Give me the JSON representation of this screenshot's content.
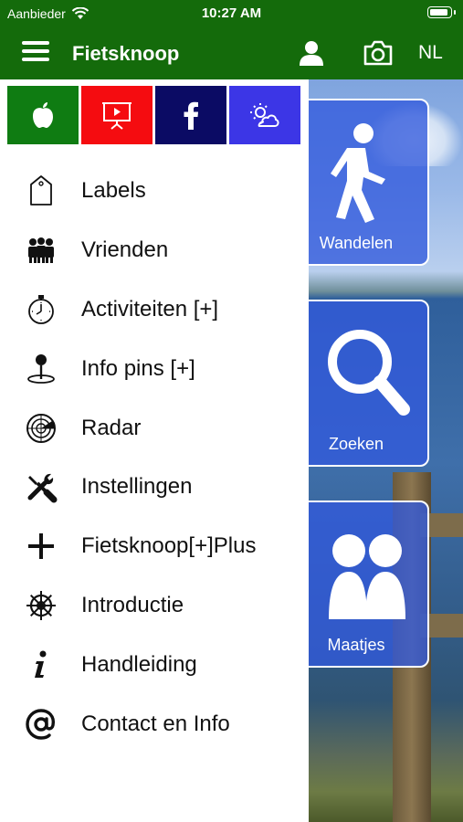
{
  "status_bar": {
    "carrier": "Aanbieder",
    "time": "10:27 AM"
  },
  "nav": {
    "title": "Fietsknoop",
    "language": "NL"
  },
  "quick_links": [
    "apple-icon",
    "presentation-icon",
    "facebook-icon",
    "weather-icon"
  ],
  "menu": {
    "items": [
      {
        "label": "Labels",
        "icon": "tag-icon"
      },
      {
        "label": "Vrienden",
        "icon": "group-icon"
      },
      {
        "label": "Activiteiten [+]",
        "icon": "stopwatch-icon"
      },
      {
        "label": "Info pins [+]",
        "icon": "map-pin-icon"
      },
      {
        "label": "Radar",
        "icon": "radar-icon"
      },
      {
        "label": "Instellingen",
        "icon": "tools-icon"
      },
      {
        "label": "Fietsknoop[+]Plus",
        "icon": "plus-icon"
      },
      {
        "label": "Introductie",
        "icon": "helm-icon"
      },
      {
        "label": "Handleiding",
        "icon": "info-icon"
      },
      {
        "label": "Contact en Info",
        "icon": "at-icon"
      }
    ]
  },
  "tiles": {
    "walk": {
      "label": "Wandelen",
      "icon": "walking-person-icon"
    },
    "search": {
      "label": "Zoeken",
      "icon": "magnifier-icon"
    },
    "buddies": {
      "label": "Maatjes",
      "icon": "people-icon"
    }
  },
  "colors": {
    "brand_green": "#146b0b",
    "tile_blue": "#325adc",
    "red": "#f50c10",
    "navy": "#0b0b64",
    "violet": "#3c36e6"
  }
}
